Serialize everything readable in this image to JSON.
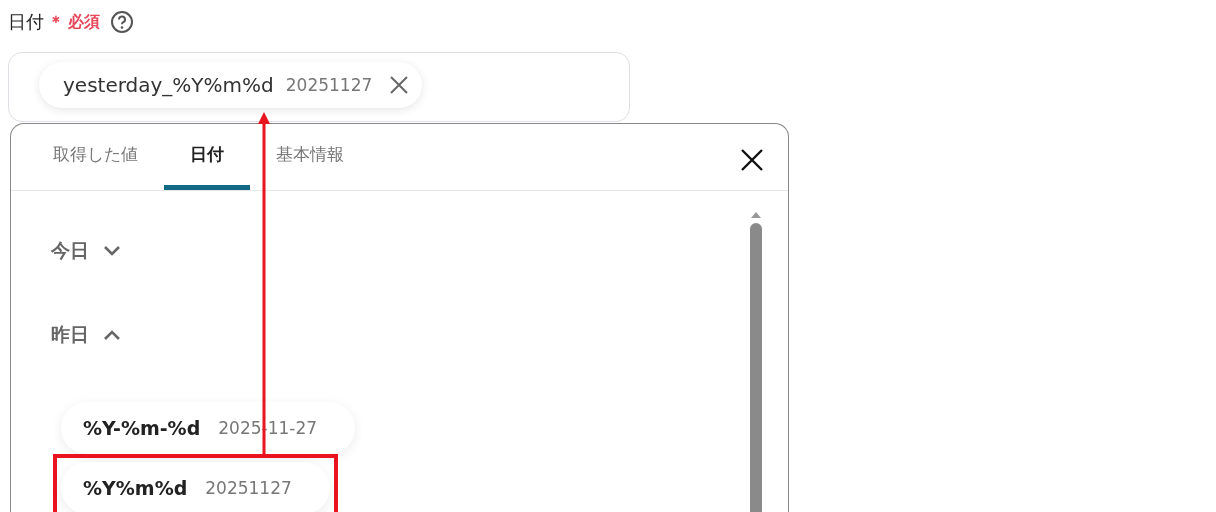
{
  "field": {
    "label": "日付",
    "required_mark": "＊",
    "required_text": "必須",
    "token": {
      "name": "yesterday_%Y%m%d",
      "value": "20251127"
    }
  },
  "picker": {
    "tabs": [
      {
        "label": "取得した値",
        "selected": false
      },
      {
        "label": "日付",
        "selected": true
      },
      {
        "label": "基本情報",
        "selected": false
      }
    ],
    "sections": [
      {
        "title": "今日",
        "expanded": false
      },
      {
        "title": "昨日",
        "expanded": true,
        "items": [
          {
            "name": "%Y-%m-%d",
            "value": "2025-11-27",
            "highlighted": false
          },
          {
            "name": "%Y%m%d",
            "value": "20251127",
            "highlighted": true
          }
        ]
      }
    ]
  }
}
